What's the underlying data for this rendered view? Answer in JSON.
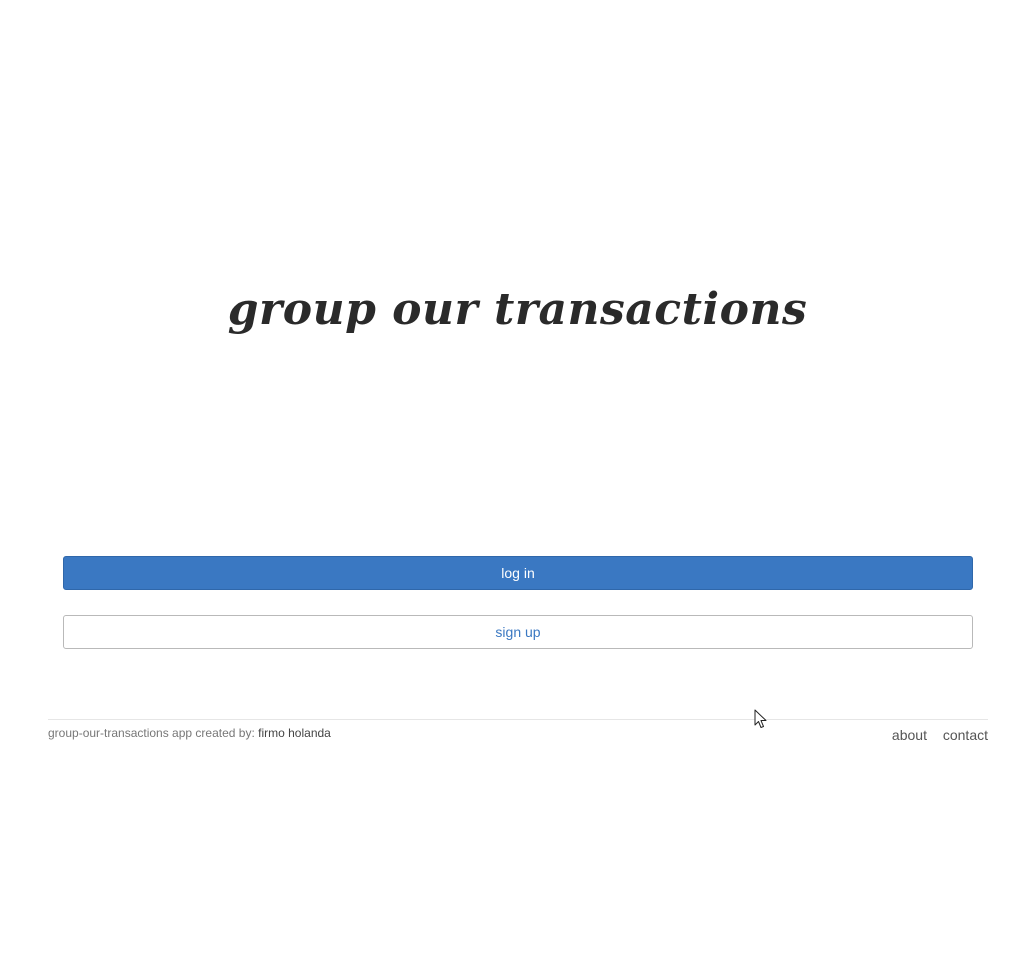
{
  "header": {
    "app_title": "group our transactions"
  },
  "actions": {
    "login_label": "log in",
    "signup_label": "sign up"
  },
  "footer": {
    "credit_prefix": "group-our-transactions app created by: ",
    "author_name": "firmo holanda",
    "links": [
      {
        "label": "about"
      },
      {
        "label": "contact"
      }
    ]
  },
  "colors": {
    "primary": "#3a78c2",
    "title_text": "#2a2a2a"
  }
}
